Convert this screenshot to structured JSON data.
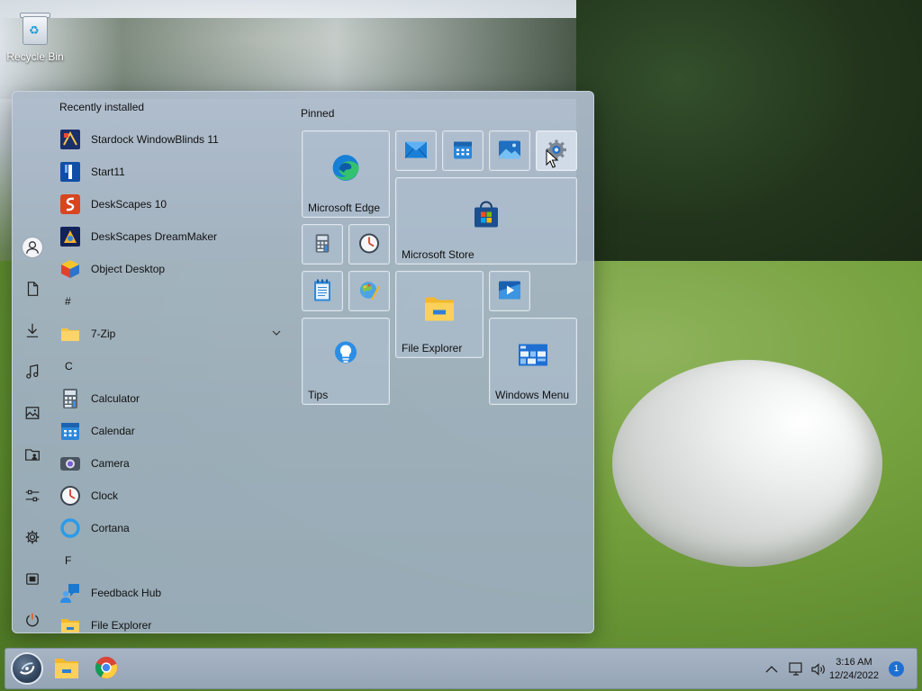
{
  "desktop": {
    "icons": [
      {
        "label": "Recycle Bin",
        "icon": "recycle-bin-icon"
      }
    ]
  },
  "start_menu": {
    "list_header": "Recently installed",
    "rail": [
      {
        "name": "user-account",
        "icon": "person-icon"
      },
      {
        "name": "documents",
        "icon": "document-icon"
      },
      {
        "name": "downloads",
        "icon": "download-icon"
      },
      {
        "name": "music",
        "icon": "music-icon"
      },
      {
        "name": "pictures",
        "icon": "pictures-icon"
      },
      {
        "name": "personal-folder",
        "icon": "user-folder-icon"
      },
      {
        "name": "control-panel",
        "icon": "sliders-icon"
      },
      {
        "name": "settings",
        "icon": "gear-icon"
      },
      {
        "name": "store",
        "icon": "store-icon"
      },
      {
        "name": "power",
        "icon": "power-icon"
      }
    ],
    "apps": [
      {
        "type": "app",
        "label": "Stardock WindowBlinds 11",
        "icon": "windowblinds-icon"
      },
      {
        "type": "app",
        "label": "Start11",
        "icon": "start11-icon"
      },
      {
        "type": "app",
        "label": "DeskScapes 10",
        "icon": "deskscapes-icon"
      },
      {
        "type": "app",
        "label": "DeskScapes DreamMaker",
        "icon": "dreammaker-icon"
      },
      {
        "type": "app",
        "label": "Object Desktop",
        "icon": "object-desktop-icon"
      },
      {
        "type": "letter",
        "label": "#"
      },
      {
        "type": "folder",
        "label": "7-Zip",
        "icon": "folder-icon"
      },
      {
        "type": "letter",
        "label": "C"
      },
      {
        "type": "app",
        "label": "Calculator",
        "icon": "calculator-icon"
      },
      {
        "type": "app",
        "label": "Calendar",
        "icon": "calendar-icon"
      },
      {
        "type": "app",
        "label": "Camera",
        "icon": "camera-icon"
      },
      {
        "type": "app",
        "label": "Clock",
        "icon": "clock-icon"
      },
      {
        "type": "app",
        "label": "Cortana",
        "icon": "cortana-icon"
      },
      {
        "type": "letter",
        "label": "F"
      },
      {
        "type": "app",
        "label": "Feedback Hub",
        "icon": "feedback-hub-icon"
      },
      {
        "type": "app",
        "label": "File Explorer",
        "icon": "file-explorer-icon"
      }
    ],
    "pinned_title": "Pinned",
    "tiles": {
      "edge": {
        "label": "Microsoft Edge",
        "icon": "edge-icon"
      },
      "mail": {
        "label": "",
        "icon": "mail-icon"
      },
      "calendar": {
        "label": "",
        "icon": "calendar-icon"
      },
      "photos": {
        "label": "",
        "icon": "photos-icon"
      },
      "settings": {
        "label": "",
        "icon": "settings-icon"
      },
      "store": {
        "label": "Microsoft Store",
        "icon": "store-icon"
      },
      "calculator": {
        "label": "",
        "icon": "calculator-icon"
      },
      "clock": {
        "label": "",
        "icon": "clock-icon"
      },
      "notepad": {
        "label": "",
        "icon": "notepad-icon"
      },
      "paint": {
        "label": "",
        "icon": "paint-icon"
      },
      "explorer": {
        "label": "File Explorer",
        "icon": "file-explorer-icon"
      },
      "media": {
        "label": "",
        "icon": "media-player-icon"
      },
      "tips": {
        "label": "Tips",
        "icon": "tips-icon"
      },
      "windows_menu": {
        "label": "Windows Menu",
        "icon": "windows-menu-icon"
      }
    }
  },
  "taskbar": {
    "start_icon": "start11-orb-icon",
    "pinned": [
      {
        "icon": "file-explorer-icon"
      },
      {
        "icon": "chrome-icon"
      }
    ],
    "tray": {
      "overflow_icon": "chevron-up-icon",
      "network_icon": "network-icon",
      "volume_icon": "volume-icon",
      "time": "3:16 AM",
      "date": "12/24/2022",
      "notification_count": "1"
    }
  },
  "colors": {
    "menu_bg": "#9aabbe",
    "tile_border": "#eef2f6",
    "accent": "#1e6fd2"
  }
}
